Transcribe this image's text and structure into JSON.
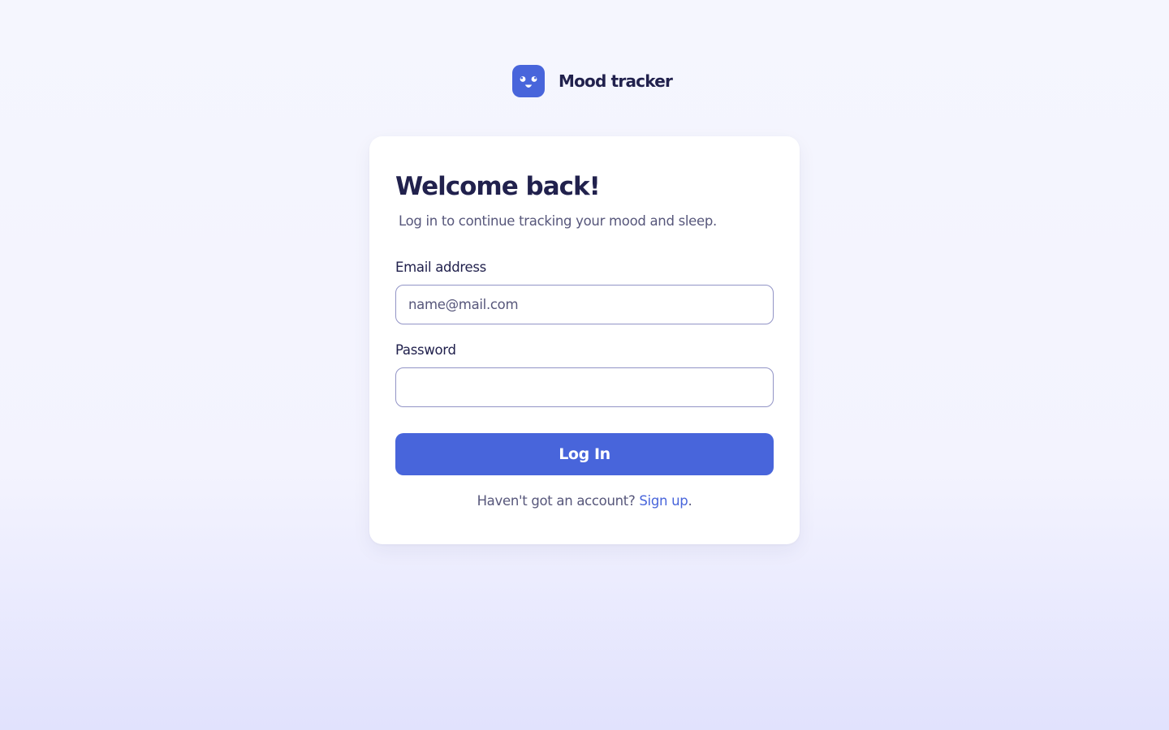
{
  "brand": {
    "logo_icon": "smiley-face-icon",
    "name": "Mood tracker"
  },
  "login": {
    "title": "Welcome back!",
    "subtitle": "Log in to continue tracking your mood and sleep.",
    "email": {
      "label": "Email address",
      "placeholder": "name@mail.com",
      "value": ""
    },
    "password": {
      "label": "Password",
      "placeholder": "",
      "value": ""
    },
    "submit_label": "Log In",
    "signup_prompt": "Haven't got an account?",
    "signup_link": "Sign up",
    "signup_suffix": "."
  },
  "colors": {
    "accent": "#4865db",
    "text_primary": "#21214d",
    "text_secondary": "#57577b",
    "input_border": "#9294c6",
    "card_background": "#ffffff",
    "page_background_top": "#f5f6fe",
    "page_background_bottom": "#e1e2fd"
  }
}
